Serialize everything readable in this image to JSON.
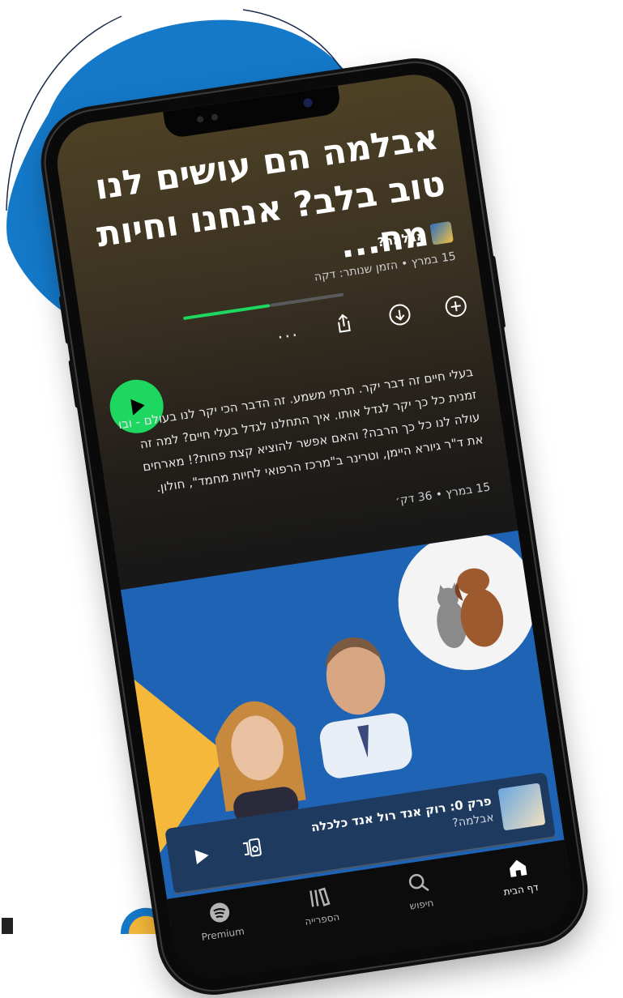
{
  "episode": {
    "title": "אבלמה הם עושים לנו טוב בלב? אנחנו וחיות המח...",
    "podcast_name": "אבלמה?",
    "meta": "15 במרץ • הזמן שנותר: דקה",
    "progress": 0.55,
    "description": "בעלי חיים זה דבר יקר. תרתי משמע. זה הדבר הכי יקר לנו בעולם - ובו זמנית כל כך יקר לגדל אותו. איך התחלנו לגדל בעלי חיים? למה זה עולה לנו כל כך הרבה? והאם אפשר להוציא קצת פחות?! מארחים את ד\"ר גיורא היימן, וטרינר ב\"מרכז הרפואי לחיות מחמד\", חולון.",
    "date_duration": "15 במרץ • 36 דק׳"
  },
  "actions": {
    "add_icon": "plus-circle-icon",
    "download_icon": "download-circle-icon",
    "share_icon": "share-icon",
    "more_label": "..."
  },
  "mini_player": {
    "title": "פרק 0: רוק אנד רול אנד כלכלה",
    "subtitle": "אבלמה?"
  },
  "nav": {
    "home": "דף הבית",
    "search": "חיפוש",
    "library": "הספרייה",
    "premium": "Premium"
  },
  "colors": {
    "accent": "#1ed760",
    "blob": "#1479c9",
    "mini_player_bg": "#1e3a5f"
  }
}
